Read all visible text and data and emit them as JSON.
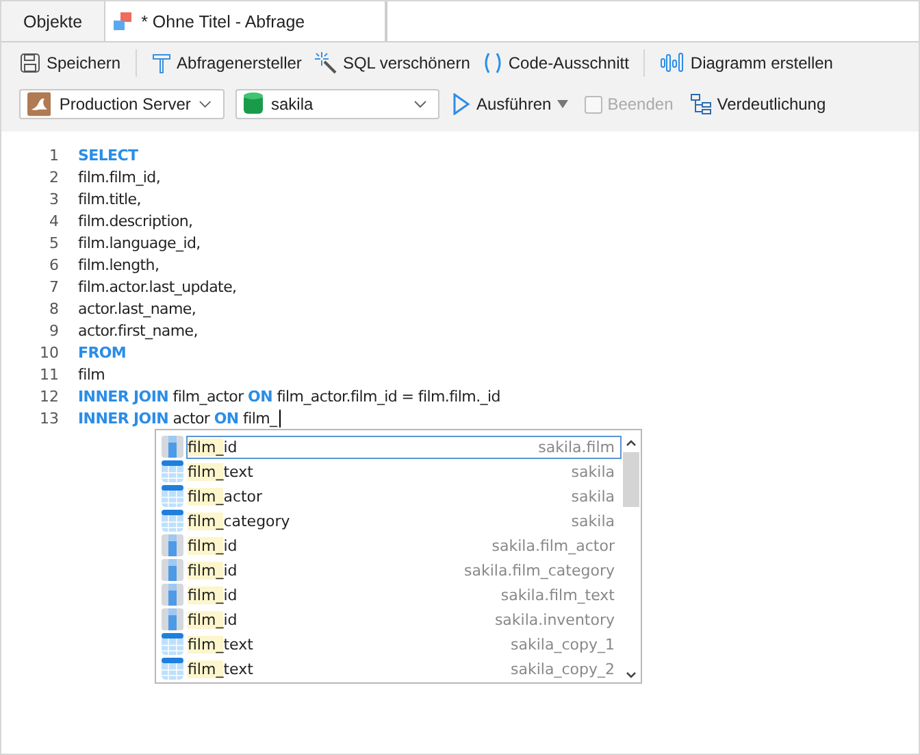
{
  "tabs": [
    {
      "label": "Objekte",
      "selected": false,
      "kind": "plain"
    },
    {
      "label": "* Ohne Titel - Abfrage",
      "selected": true,
      "kind": "query"
    }
  ],
  "toolbar": [
    {
      "label": "Speichern",
      "kind": "save"
    },
    {
      "label": "Abfragenersteller",
      "kind": "builder"
    },
    {
      "label": "SQL verschönern",
      "kind": "beautify"
    },
    {
      "label": "Code-Ausschnitt",
      "kind": "snippet"
    },
    {
      "label": "Diagramm erstellen",
      "kind": "chart"
    }
  ],
  "connection": {
    "value": "Production Server"
  },
  "database": {
    "value": "sakila"
  },
  "run": {
    "label": "Ausführen"
  },
  "stop": {
    "label": "Beenden",
    "disabled": true
  },
  "explain": {
    "label": "Verdeutlichung"
  },
  "code_lines": [
    {
      "number": "1",
      "tokens": [
        {
          "text": "SELECT",
          "kind": "kw"
        }
      ]
    },
    {
      "number": "2",
      "tokens": [
        {
          "text": "film.film_id,",
          "kind": "text"
        }
      ]
    },
    {
      "number": "3",
      "tokens": [
        {
          "text": "film.title,",
          "kind": "text"
        }
      ]
    },
    {
      "number": "4",
      "tokens": [
        {
          "text": "film.description,",
          "kind": "text"
        }
      ]
    },
    {
      "number": "5",
      "tokens": [
        {
          "text": "film.language_id,",
          "kind": "text"
        }
      ]
    },
    {
      "number": "6",
      "tokens": [
        {
          "text": "film.length,",
          "kind": "text"
        }
      ]
    },
    {
      "number": "7",
      "tokens": [
        {
          "text": "film.actor.last_update,",
          "kind": "text"
        }
      ]
    },
    {
      "number": "8",
      "tokens": [
        {
          "text": "actor.last_name,",
          "kind": "text"
        }
      ]
    },
    {
      "number": "9",
      "tokens": [
        {
          "text": "actor.first_name,",
          "kind": "text"
        }
      ]
    },
    {
      "number": "10",
      "tokens": [
        {
          "text": "FROM",
          "kind": "kw"
        }
      ]
    },
    {
      "number": "11",
      "tokens": [
        {
          "text": "film",
          "kind": "text"
        }
      ]
    },
    {
      "number": "12",
      "tokens": [
        {
          "text": "INNER JOIN",
          "kind": "kw"
        },
        {
          "text": "film_actor",
          "kind": "text"
        },
        {
          "text": "ON",
          "kind": "kw"
        },
        {
          "text": "film_actor.film_id = film.film._id",
          "kind": "text"
        }
      ]
    },
    {
      "number": "13",
      "tokens": [
        {
          "text": "INNER JOIN",
          "kind": "kw"
        },
        {
          "text": "actor",
          "kind": "text"
        },
        {
          "text": "ON",
          "kind": "kw"
        },
        {
          "text": "film_",
          "kind": "text"
        }
      ],
      "cursor": true
    }
  ],
  "suggestions": [
    {
      "match": "film_",
      "rest": "id",
      "source": "sakila.film",
      "kind": "column",
      "selected": true
    },
    {
      "match": "film_",
      "rest": "text",
      "source": "sakila",
      "kind": "table",
      "selected": false
    },
    {
      "match": "film_",
      "rest": "actor",
      "source": "sakila",
      "kind": "table",
      "selected": false
    },
    {
      "match": "film_",
      "rest": "category",
      "source": "sakila",
      "kind": "table",
      "selected": false
    },
    {
      "match": "film_",
      "rest": "id",
      "source": "sakila.film_actor",
      "kind": "column",
      "selected": false
    },
    {
      "match": "film_",
      "rest": "id",
      "source": "sakila.film_category",
      "kind": "column",
      "selected": false
    },
    {
      "match": "film_",
      "rest": "id",
      "source": "sakila.film_text",
      "kind": "column",
      "selected": false
    },
    {
      "match": "film_",
      "rest": "id",
      "source": "sakila.inventory",
      "kind": "column",
      "selected": false
    },
    {
      "match": "film_",
      "rest": "text",
      "source": "sakila_copy_1",
      "kind": "table",
      "selected": false
    },
    {
      "match": "film_",
      "rest": "text",
      "source": "sakila_copy_2",
      "kind": "table",
      "selected": false
    }
  ]
}
